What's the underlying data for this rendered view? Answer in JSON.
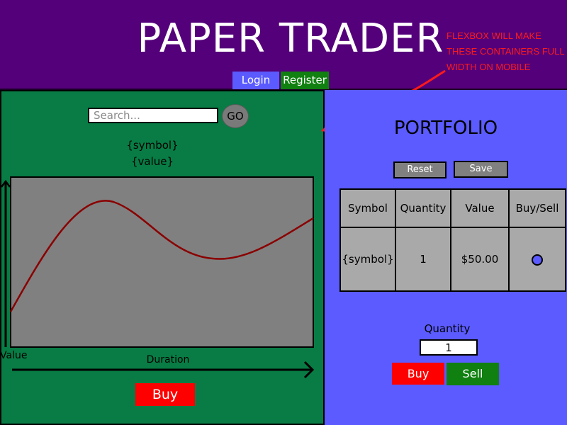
{
  "header": {
    "title": "PAPER TRADER",
    "login_label": "Login",
    "register_label": "Register",
    "annotation": "FLEXBOX WILL MAKE THESE CONTAINERS FULL WIDTH ON MOBILE"
  },
  "search": {
    "placeholder": "Search...",
    "value": "",
    "go_label": "GO"
  },
  "chart_panel": {
    "symbol_placeholder": "{symbol}",
    "value_placeholder": "{value}",
    "buy_label": "Buy"
  },
  "chart_data": {
    "type": "line",
    "xlabel": "Duration",
    "ylabel": "Value",
    "series_color": "#8a0000",
    "plot_background": "#808080",
    "grid": false,
    "legend": "none"
  },
  "portfolio": {
    "title": "PORTFOLIO",
    "reset_label": "Reset",
    "save_label": "Save",
    "columns": [
      "Symbol",
      "Quantity",
      "Value",
      "Buy/Sell"
    ],
    "rows": [
      {
        "symbol": "{symbol}",
        "quantity": "1",
        "value": "$50.00",
        "buy_sell": "radio"
      }
    ],
    "quantity_label": "Quantity",
    "quantity_value": "1",
    "buy_label": "Buy",
    "sell_label": "Sell"
  },
  "colors": {
    "header_bg": "#54007a",
    "left_bg": "#087c44",
    "right_bg": "#5b5bff",
    "buy": "#ff0000",
    "sell": "#108010",
    "annotation": "#ff1a1a"
  }
}
